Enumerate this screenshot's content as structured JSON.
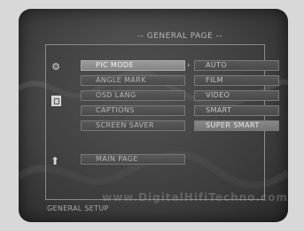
{
  "header": {
    "title": "-- GENERAL PAGE --"
  },
  "icons": {
    "top": "gear-icon",
    "middle": "page-icon",
    "bottom": "up-arrow-icon"
  },
  "menu": {
    "items": [
      {
        "label": "PIC MODE",
        "active": true
      },
      {
        "label": "ANGLE MARK",
        "active": false
      },
      {
        "label": "OSD LANG",
        "active": false
      },
      {
        "label": "CAPTIONS",
        "active": false
      },
      {
        "label": "SCREEN SAVER",
        "active": false
      }
    ],
    "main_page": "MAIN PAGE"
  },
  "options": {
    "items": [
      {
        "label": "AUTO",
        "selected": false
      },
      {
        "label": "FILM",
        "selected": false
      },
      {
        "label": "VIDEO",
        "selected": false
      },
      {
        "label": "SMART",
        "selected": false
      },
      {
        "label": "SUPER SMART",
        "selected": true
      }
    ]
  },
  "watermark": "www.DigitalHifiTechno.com",
  "footer": {
    "text": "GENERAL SETUP"
  },
  "colors": {
    "background": "#474747",
    "active_highlight": "#9a9a9a",
    "text": "#c4c4c4"
  }
}
